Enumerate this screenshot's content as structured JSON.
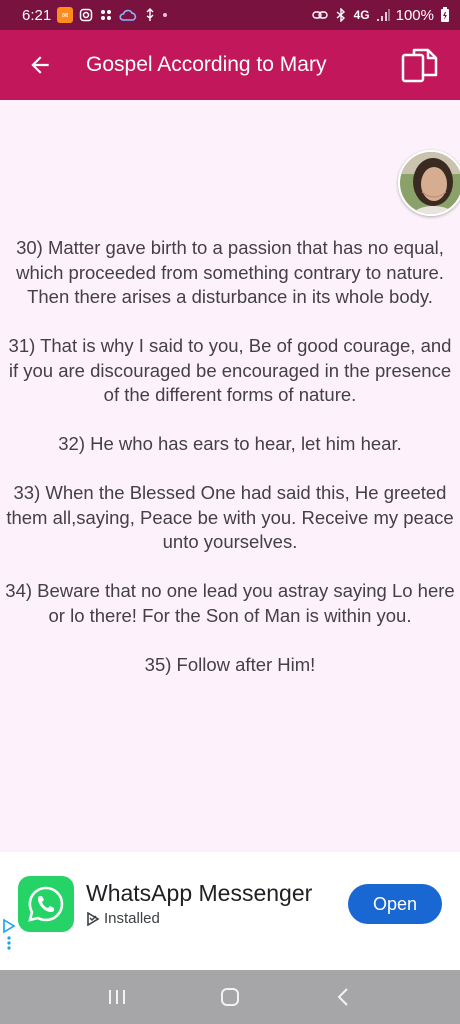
{
  "status_bar": {
    "time": "6:21",
    "network": "4G",
    "battery": "100%"
  },
  "app_bar": {
    "title": "Gospel According to Mary",
    "back_icon": "arrow-left-icon",
    "action_icon": "copy-icon"
  },
  "content": {
    "paragraphs": [
      "30) Matter gave birth to a passion that has no equal, which proceeded from something contrary to nature. Then there arises a disturbance in its whole body.",
      "31) That is why I said to you, Be of good courage, and if you are discouraged be encouraged in the presence of the different forms of nature.",
      "32) He who has ears to hear, let him hear.",
      "33) When the Blessed One had said this, He greeted them all,saying, Peace be with you. Receive my peace unto yourselves.",
      "34) Beware that no one lead you astray saying Lo here or lo there! For the Son of Man is within you.",
      "35) Follow after Him!"
    ]
  },
  "ad": {
    "app_name": "WhatsApp Messenger",
    "status": "Installed",
    "button_label": "Open"
  },
  "nav": {
    "recents_icon": "recents-icon",
    "home_icon": "home-icon",
    "back_icon": "back-icon"
  },
  "colors": {
    "status_bar": "#7a1240",
    "app_bar": "#c2185b",
    "background": "#fdf2fb",
    "open_button": "#1967d2",
    "whatsapp": "#25d366"
  }
}
